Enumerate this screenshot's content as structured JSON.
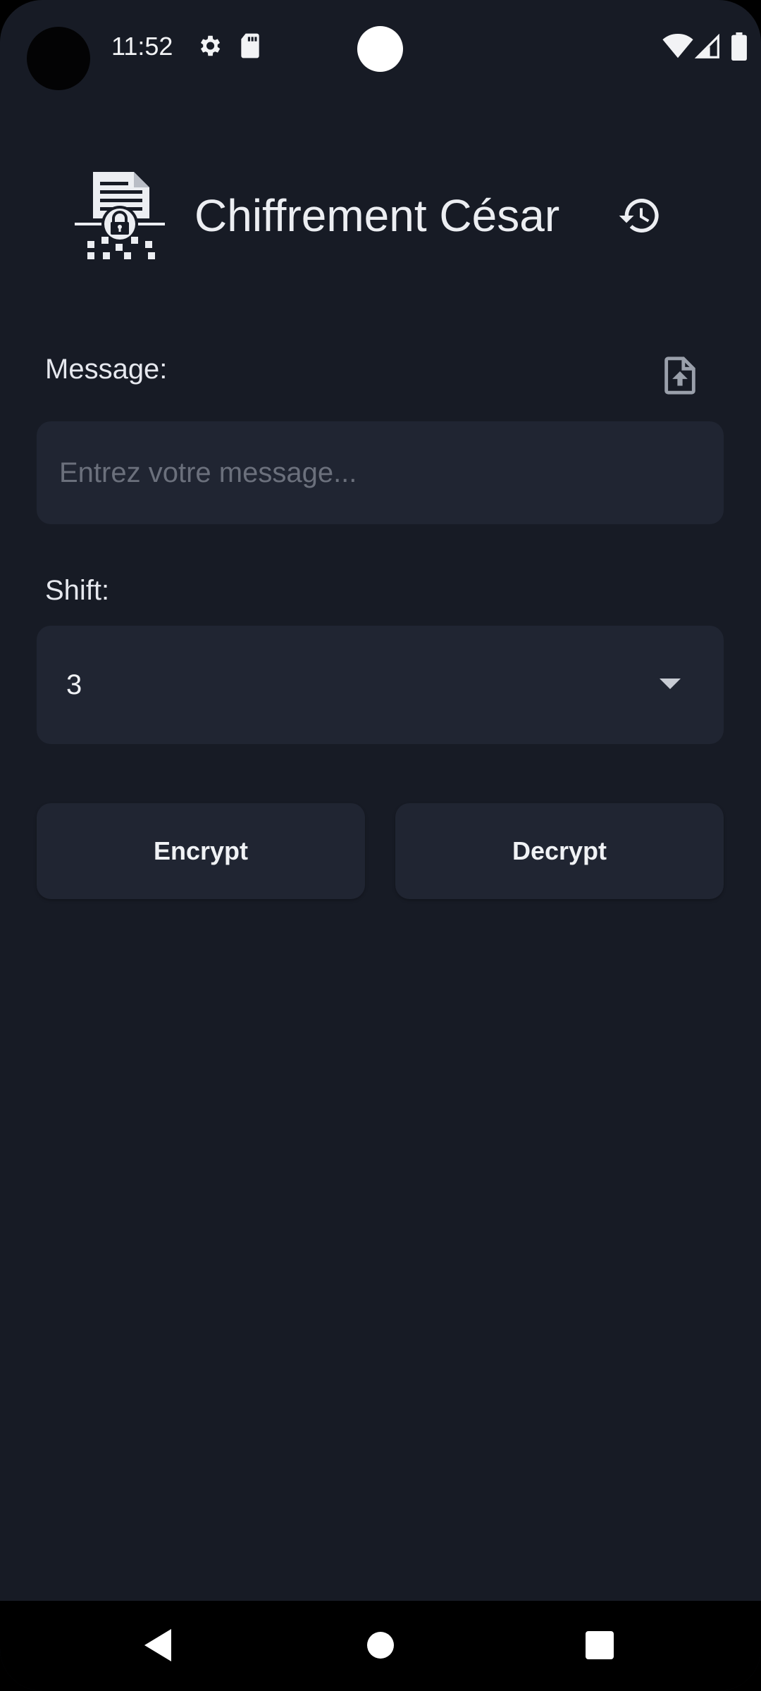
{
  "status_bar": {
    "time": "11:52",
    "icons": [
      "settings-icon",
      "sd-card-icon",
      "wifi-icon",
      "signal-icon",
      "battery-icon"
    ]
  },
  "header": {
    "title": "Chiffrement César",
    "logo_icon": "encrypted-document-icon",
    "history_icon": "history-icon"
  },
  "message": {
    "label": "Message:",
    "placeholder": "Entrez votre message...",
    "value": "",
    "upload_icon": "file-upload-icon"
  },
  "shift": {
    "label": "Shift:",
    "selected": "3"
  },
  "actions": {
    "encrypt_label": "Encrypt",
    "decrypt_label": "Decrypt"
  },
  "nav_bar": {
    "icons": [
      "back-icon",
      "home-icon",
      "recents-icon"
    ]
  },
  "colors": {
    "background": "#171b25",
    "surface": "#202532",
    "text": "#eceef2",
    "placeholder": "#6b707c"
  }
}
